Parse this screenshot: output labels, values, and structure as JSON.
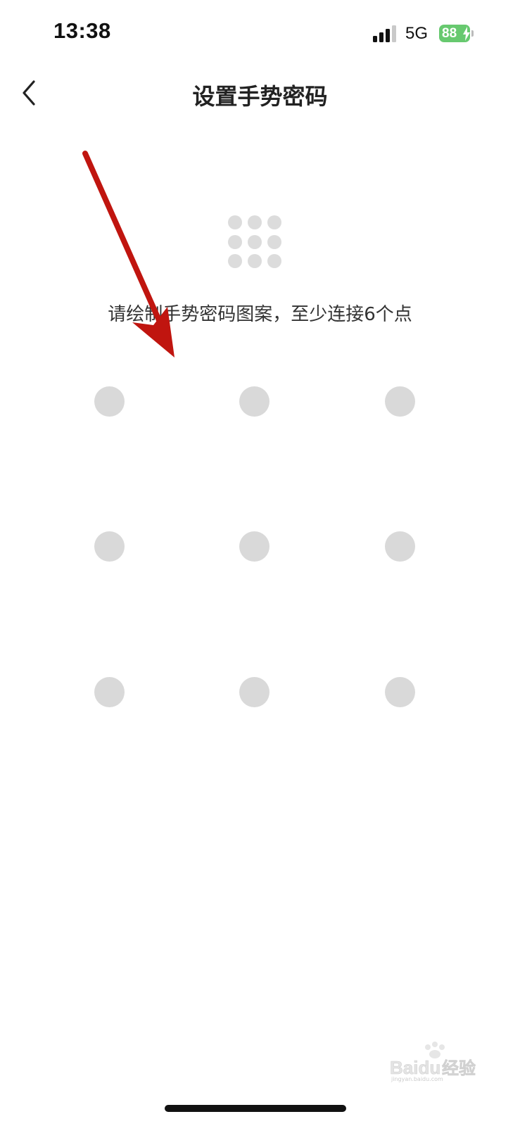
{
  "status_bar": {
    "time": "13:38",
    "network": "5G",
    "battery_level": "88",
    "battery_color": "#67c96f",
    "battery_icon": "battery-charging-icon",
    "signal_icon": "cellular-signal-icon"
  },
  "nav": {
    "back_icon": "chevron-left-icon",
    "title": "设置手势密码"
  },
  "pattern_icon": "gesture-grid-icon",
  "hint": "请绘制手势密码图案，至少连接6个点",
  "gesture_grid": {
    "rows": 3,
    "cols": 3,
    "dot_color": "#d9d9d9",
    "points": [
      "1",
      "2",
      "3",
      "4",
      "5",
      "6",
      "7",
      "8",
      "9"
    ]
  },
  "annotation": {
    "type": "red-arrow",
    "color": "#c0150f"
  },
  "watermark": {
    "brand_text": "Baidu经验",
    "sub_text": "jingyan.baidu.com"
  }
}
